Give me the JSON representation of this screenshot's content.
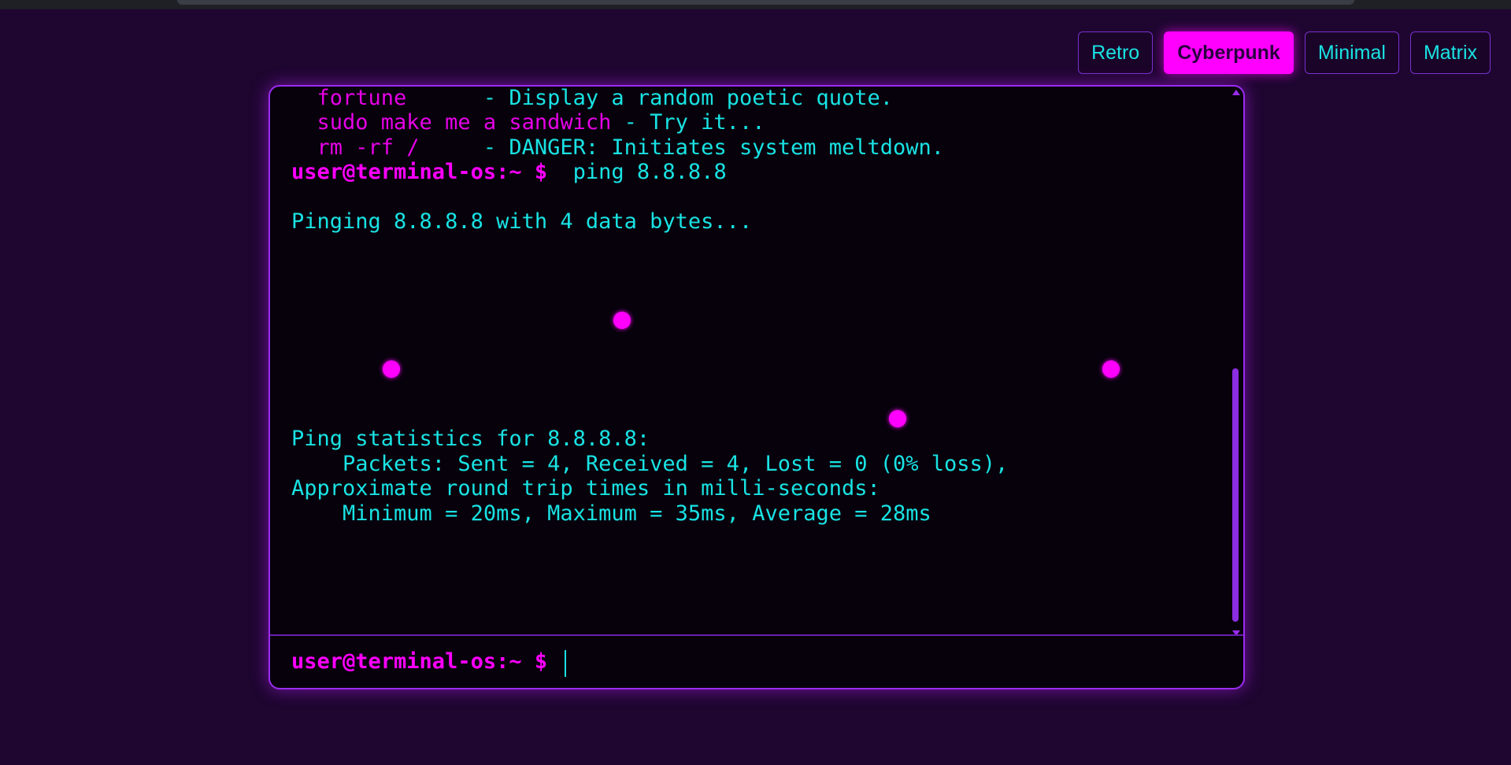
{
  "themes": {
    "retro": "Retro",
    "cyberpunk": "Cyberpunk",
    "minimal": "Minimal",
    "matrix": "Matrix",
    "active": "Cyberpunk"
  },
  "terminal": {
    "help_lines": [
      {
        "cmd": "  fortune      ",
        "desc": "- Display a random poetic quote."
      },
      {
        "cmd": "  sudo make me a sandwich ",
        "desc": "- Try it..."
      },
      {
        "cmd": "  rm -rf /     ",
        "desc": "- DANGER: Initiates system meltdown."
      }
    ],
    "prompt": "user@terminal-os:~ $ ",
    "last_command": " ping 8.8.8.8",
    "ping_header": "Pinging 8.8.8.8 with 4 data bytes...",
    "stats_title": "Ping statistics for 8.8.8.8:",
    "packets_line": "    Packets: Sent = 4, Received = 4, Lost = 0 (0% loss),",
    "rtt_title": "Approximate round trip times in milli-seconds:",
    "rtt_values": "    Minimum = 20ms, Maximum = 35ms, Average = 28ms",
    "input_prompt": "user@terminal-os:~ $ ",
    "input_value": ""
  },
  "colors": {
    "background": "#1e0630",
    "accent": "#ff00ff",
    "text": "#19e3e3",
    "border": "#9a2cf0"
  }
}
